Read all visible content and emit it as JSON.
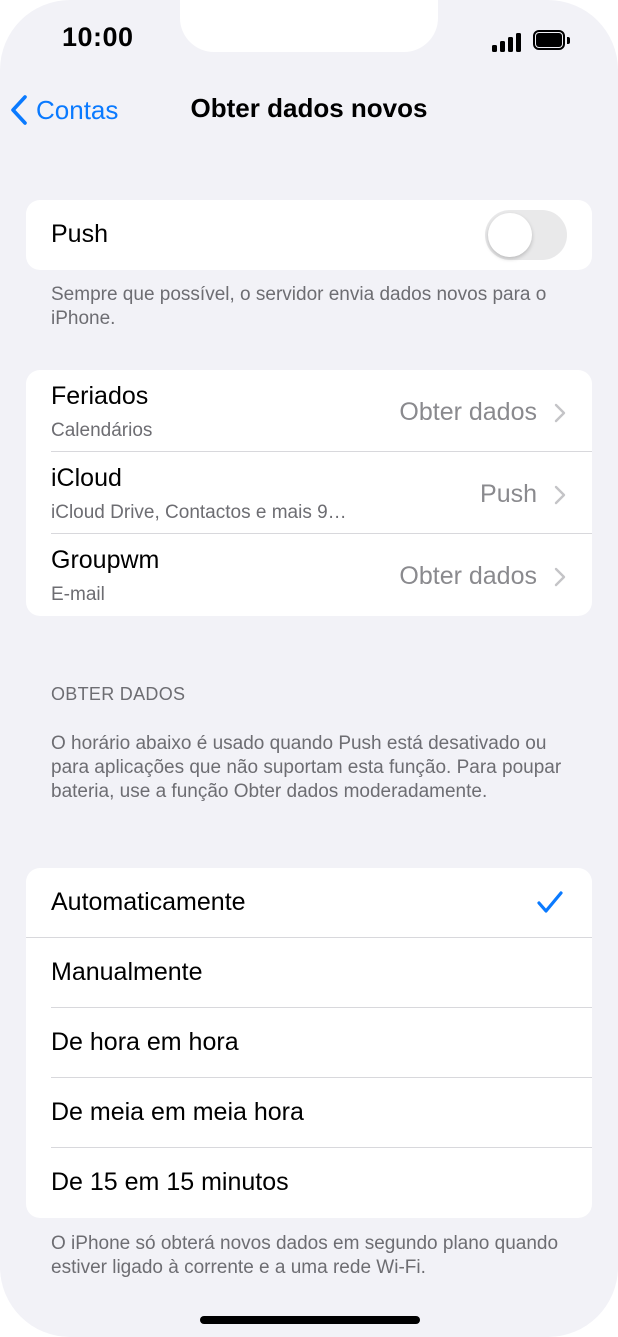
{
  "status_bar": {
    "time": "10:00"
  },
  "nav": {
    "back_label": "Contas",
    "title": "Obter dados novos"
  },
  "push": {
    "label": "Push",
    "enabled": false,
    "footnote": "Sempre que possível, o servidor envia dados novos para o iPhone."
  },
  "accounts": [
    {
      "name": "Feriados",
      "subtitle": "Calendários",
      "value": "Obter dados"
    },
    {
      "name": "iCloud",
      "subtitle": "iCloud Drive, Contactos e mais 9…",
      "value": "Push"
    },
    {
      "name": "Groupwm",
      "subtitle": "E-mail",
      "value": "Obter dados"
    }
  ],
  "fetch": {
    "header": "OBTER DADOS",
    "description": "O horário abaixo é usado quando Push está desativado ou para aplicações que não suportam esta função. Para poupar bateria, use a função Obter dados moderadamente.",
    "options": [
      {
        "label": "Automaticamente",
        "selected": true
      },
      {
        "label": "Manualmente",
        "selected": false
      },
      {
        "label": "De hora em hora",
        "selected": false
      },
      {
        "label": "De meia em meia hora",
        "selected": false
      },
      {
        "label": "De 15 em 15 minutos",
        "selected": false
      }
    ],
    "footnote": "O iPhone só obterá novos dados em segundo plano quando estiver ligado à corrente e a uma rede Wi-Fi."
  },
  "colors": {
    "accent": "#0a7aff",
    "background": "#f2f2f7",
    "secondary_text": "#6d6d72"
  }
}
